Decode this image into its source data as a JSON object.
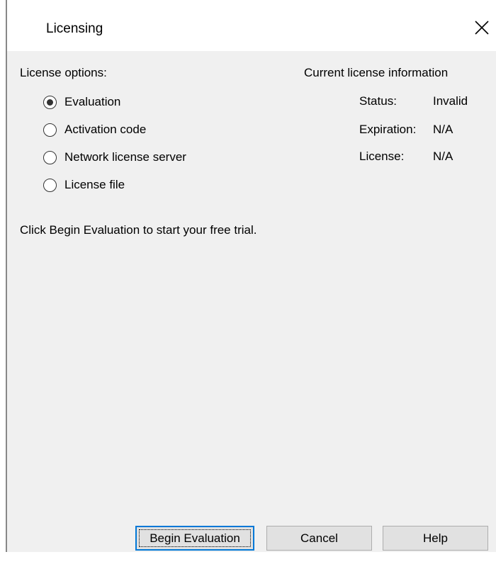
{
  "window": {
    "title": "Licensing"
  },
  "license_options": {
    "heading": "License options:",
    "selected": "Evaluation",
    "items": [
      {
        "label": "Evaluation",
        "checked": true
      },
      {
        "label": "Activation code",
        "checked": false
      },
      {
        "label": "Network license server",
        "checked": false
      },
      {
        "label": "License file",
        "checked": false
      }
    ]
  },
  "current_info": {
    "heading": "Current license information",
    "status_label": "Status:",
    "status_value": "Invalid",
    "expiration_label": "Expiration:",
    "expiration_value": "N/A",
    "license_label": "License:",
    "license_value": "N/A"
  },
  "message": "Click Begin Evaluation to start your free trial.",
  "buttons": {
    "begin": "Begin Evaluation",
    "cancel": "Cancel",
    "help": "Help"
  },
  "colors": {
    "client_bg": "#f0f0f0",
    "button_bg": "#e1e1e1",
    "focus_border": "#0078d7"
  }
}
